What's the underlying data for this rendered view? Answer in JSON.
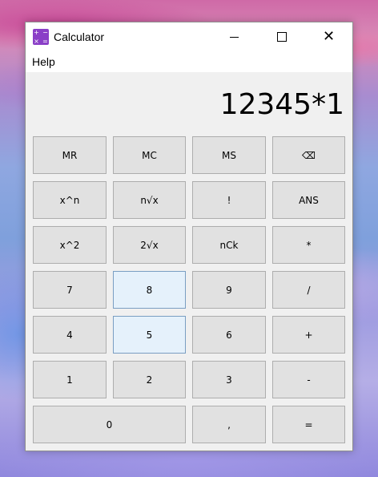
{
  "window": {
    "title": "Calculator",
    "close_glyph": "✕"
  },
  "menu": {
    "help": "Help"
  },
  "display": {
    "value": "12345*1"
  },
  "keys": {
    "mr": "MR",
    "mc": "MC",
    "ms": "MS",
    "backspace": "⌫",
    "power": "x^n",
    "nth_root": "n√x",
    "factorial": "!",
    "ans": "ANS",
    "square": "x^2",
    "square_root": "2√x",
    "ncr": "nCk",
    "multiply": "*",
    "d7": "7",
    "d8": "8",
    "d9": "9",
    "divide": "/",
    "d4": "4",
    "d5": "5",
    "d6": "6",
    "plus": "+",
    "d1": "1",
    "d2": "2",
    "d3": "3",
    "minus": "-",
    "d0": "0",
    "comma": ",",
    "equals": "="
  },
  "colors": {
    "accent_icon": "#8a3fc7",
    "key_bg": "#e1e1e1",
    "key_hover_bg": "#e5f1fb"
  }
}
